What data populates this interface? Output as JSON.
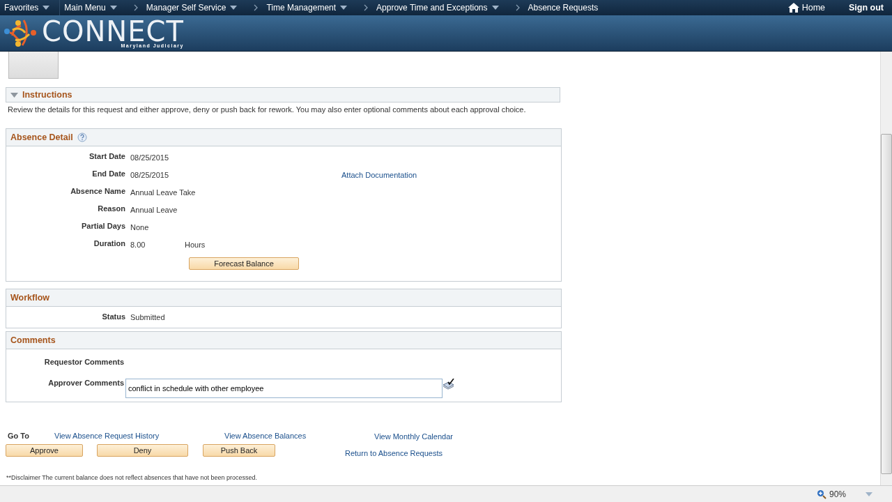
{
  "nav": {
    "items": [
      {
        "label": "Favorites",
        "dropdown": true,
        "chevron": false
      },
      {
        "label": "Main Menu",
        "dropdown": true,
        "chevron": false
      },
      {
        "label": "Manager Self Service",
        "dropdown": true,
        "chevron": true
      },
      {
        "label": "Time Management",
        "dropdown": true,
        "chevron": true
      },
      {
        "label": "Approve Time and Exceptions",
        "dropdown": true,
        "chevron": true
      },
      {
        "label": "Absence Requests",
        "dropdown": false,
        "chevron": true
      }
    ],
    "home": "Home",
    "sign_out": "Sign out"
  },
  "banner": {
    "logo_text": "CONNECT",
    "logo_subtitle": "Maryland Judiciary"
  },
  "instructions": {
    "title": "Instructions",
    "expanded": true,
    "text": "Review the details for this request and either approve, deny or push back for rework. You may also enter optional comments about each approval choice."
  },
  "absence_detail": {
    "title": "Absence Detail",
    "rows": [
      {
        "label": "Start Date",
        "value": "08/25/2015"
      },
      {
        "label": "End Date",
        "value": "08/25/2015",
        "link": "Attach Documentation"
      },
      {
        "label": "Absence Name",
        "value": "Annual Leave Take"
      },
      {
        "label": "Reason",
        "value": "Annual Leave"
      },
      {
        "label": "Partial Days",
        "value": "None"
      },
      {
        "label": "Duration",
        "value": "8.00",
        "unit": "Hours"
      }
    ],
    "button": "Forecast Balance"
  },
  "workflow": {
    "title": "Workflow",
    "label": "Status",
    "value": "Submitted"
  },
  "comments": {
    "title": "Comments",
    "requestor_label": "Requestor Comments",
    "approver_label": "Approver Comments",
    "approver_value": "conflict in schedule with other employee"
  },
  "go_to": {
    "label": "Go To",
    "links": [
      "View Absence Request History",
      "View Absence Balances",
      "View Monthly Calendar"
    ]
  },
  "actions": {
    "buttons": [
      "Approve",
      "Deny",
      "Push Back"
    ],
    "link": "Return to Absence Requests"
  },
  "disclaimer": {
    "mark": "**",
    "text": "Disclaimer  The current balance does not reflect absences that have not been processed."
  },
  "status_bar": {
    "zoom": "90%"
  }
}
